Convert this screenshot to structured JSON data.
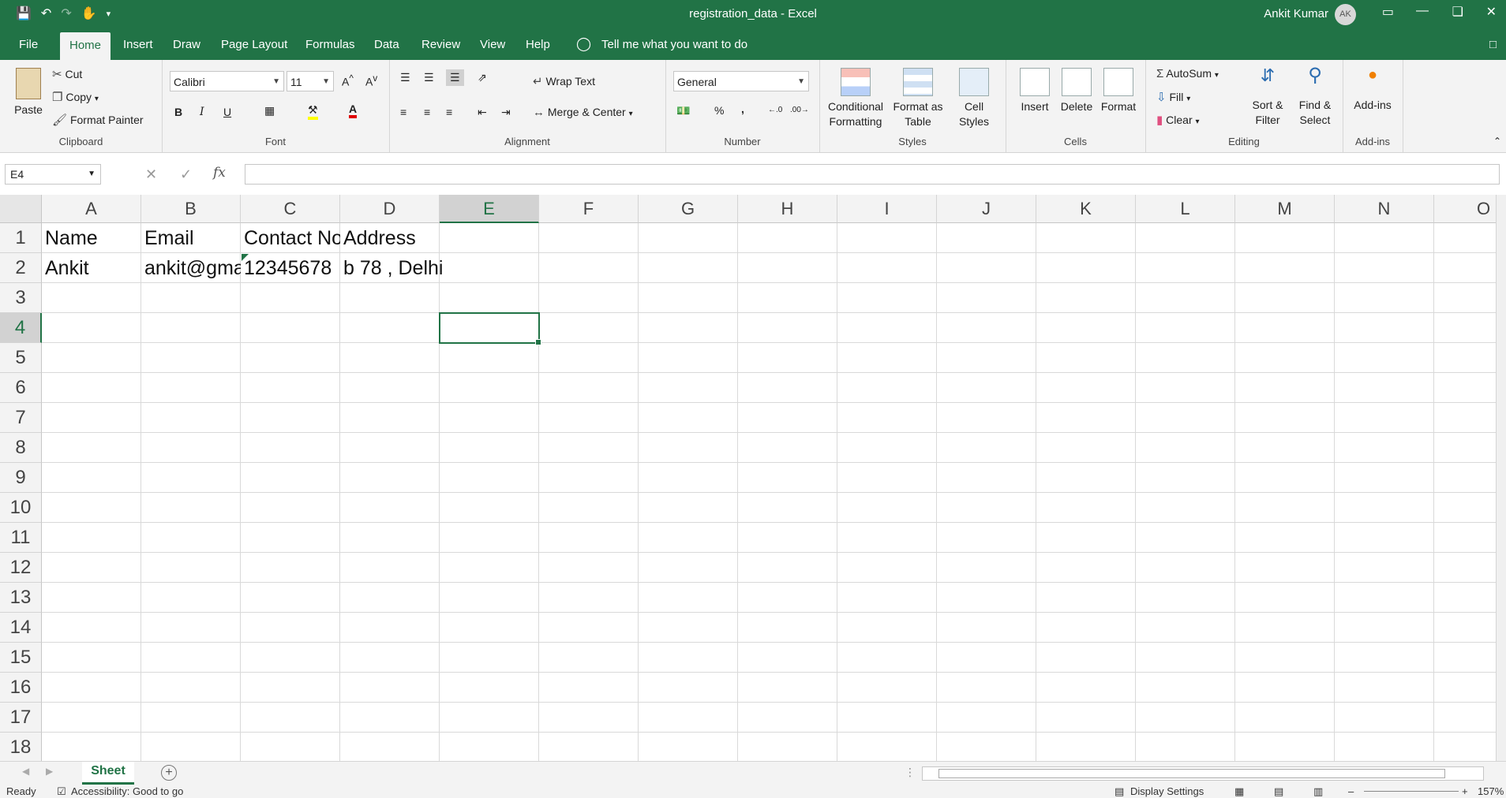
{
  "titlebar": {
    "title": "registration_data  -  Excel",
    "user_name": "Ankit Kumar",
    "user_initials": "AK"
  },
  "tabs": [
    "File",
    "Home",
    "Insert",
    "Draw",
    "Page Layout",
    "Formulas",
    "Data",
    "Review",
    "View",
    "Help"
  ],
  "tell_me": "Tell me what you want to do",
  "ribbon": {
    "clipboard": {
      "label": "Clipboard",
      "paste": "Paste",
      "cut": "Cut",
      "copy": "Copy",
      "format_painter": "Format Painter"
    },
    "font": {
      "label": "Font",
      "font_name": "Calibri",
      "font_size": "11",
      "bold": "B",
      "italic": "I",
      "underline": "U"
    },
    "alignment": {
      "label": "Alignment",
      "wrap_text": "Wrap Text",
      "merge_center": "Merge & Center"
    },
    "number": {
      "label": "Number",
      "format": "General",
      "percent": "%",
      "comma": ","
    },
    "styles": {
      "label": "Styles",
      "conditional_formatting": [
        "Conditional",
        "Formatting"
      ],
      "format_as_table": [
        "Format as",
        "Table"
      ],
      "cell_styles": [
        "Cell",
        "Styles"
      ]
    },
    "cells": {
      "label": "Cells",
      "insert": "Insert",
      "delete": "Delete",
      "format": "Format"
    },
    "editing": {
      "label": "Editing",
      "autosum": "AutoSum",
      "fill": "Fill",
      "clear": "Clear",
      "sort_filter": [
        "Sort &",
        "Filter"
      ],
      "find_select": [
        "Find &",
        "Select"
      ]
    },
    "addins": {
      "label": "Add-ins",
      "addins": "Add-ins"
    }
  },
  "formula_bar": {
    "name_box": "E4",
    "fx": "fx",
    "formula": ""
  },
  "grid": {
    "columns": [
      "A",
      "B",
      "C",
      "D",
      "E",
      "F",
      "G",
      "H",
      "I",
      "J",
      "K",
      "L",
      "M",
      "N",
      "O"
    ],
    "rows": [
      "1",
      "2",
      "3",
      "4",
      "5",
      "6",
      "7",
      "8",
      "9",
      "10",
      "11",
      "12",
      "13",
      "14",
      "15",
      "16",
      "17",
      "18"
    ],
    "selected_column": "E",
    "selected_row": "4",
    "cells": {
      "A1": "Name",
      "B1": "Email",
      "C1": "Contact No",
      "D1": "Address",
      "A2": "Ankit",
      "B2": "ankit@gmail.com",
      "C2": "12345678",
      "D2": "b 78 , Delhi"
    }
  },
  "sheets": {
    "active": "Sheet"
  },
  "status": {
    "ready": "Ready",
    "accessibility": "Accessibility: Good to go",
    "display_settings": "Display Settings",
    "zoom": "157%"
  }
}
